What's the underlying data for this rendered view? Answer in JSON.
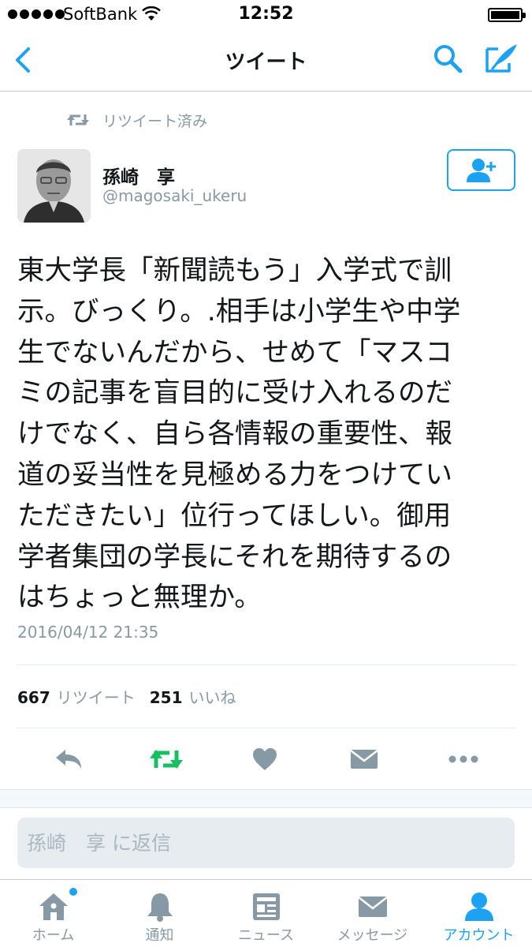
{
  "status_bar": {
    "carrier": "SoftBank",
    "time": "12:52"
  },
  "nav": {
    "title": "ツイート"
  },
  "tweet": {
    "retweeted_label": "リツイート済み",
    "author_name": "孫崎　享",
    "author_handle": "@magosaki_ukeru",
    "text_lines": [
      "東大学長「新聞読もう」入学式で訓",
      "示。びっくり。.相手は小学生や中学",
      "生でないんだから、せめて「マスコ",
      "ミの記事を盲目的に受け入れるのだ",
      "けでなく、自ら各情報の重要性、報",
      "道の妥当性を見極める力をつけてい",
      "ただきたい」位行ってほしい。御用",
      "学者集団の学長にそれを期待するの",
      "はちょっと無理か。"
    ],
    "timestamp": "2016/04/12 21:35",
    "retweet_count": "667",
    "retweet_label": "リツイート",
    "like_count": "251",
    "like_label": "いいね"
  },
  "reply": {
    "placeholder": "孫崎　享 に返信"
  },
  "tabs": [
    {
      "label": "ホーム",
      "icon": "home-icon"
    },
    {
      "label": "通知",
      "icon": "bell-icon"
    },
    {
      "label": "ニュース",
      "icon": "news-icon"
    },
    {
      "label": "メッセージ",
      "icon": "envelope-icon"
    },
    {
      "label": "アカウント",
      "icon": "person-icon"
    }
  ],
  "colors": {
    "accent": "#1da1f2",
    "retweet_active": "#17bf63",
    "muted": "#8899a6"
  }
}
